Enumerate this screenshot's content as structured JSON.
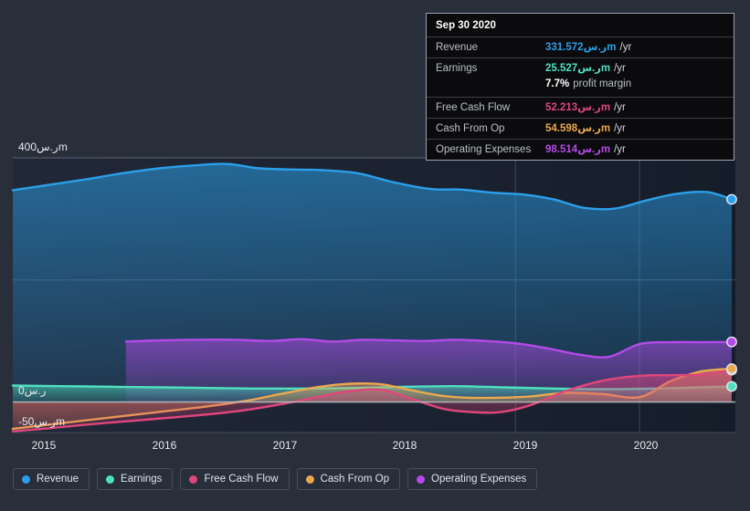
{
  "colors": {
    "background": "#282e3a",
    "plot_background": "#1b2230",
    "revenue": "#2b9fe8",
    "earnings": "#4fe0c0",
    "free_cash_flow": "#e0467c",
    "cash_from_op": "#eaa84f",
    "operating_expenses": "#b44ae8",
    "zero_line": "#b9c0c8",
    "grid": "#4a5264"
  },
  "tooltip": {
    "title": "Sep 30 2020",
    "rows": [
      {
        "label": "Revenue",
        "value": "331.572ر.سm",
        "unit": "/yr",
        "color": "#2b9fe8"
      },
      {
        "label": "Earnings",
        "value": "25.527ر.سm",
        "unit": "/yr",
        "color": "#4fe0c0"
      },
      {
        "label": "Free Cash Flow",
        "value": "52.213ر.سm",
        "unit": "/yr",
        "color": "#e0467c"
      },
      {
        "label": "Cash From Op",
        "value": "54.598ر.سm",
        "unit": "/yr",
        "color": "#eaa84f"
      },
      {
        "label": "Operating Expenses",
        "value": "98.514ر.سm",
        "unit": "/yr",
        "color": "#b44ae8"
      }
    ],
    "profit_margin_value": "7.7%",
    "profit_margin_label": "profit margin"
  },
  "legend": {
    "items": [
      {
        "label": "Revenue",
        "color": "#2b9fe8"
      },
      {
        "label": "Earnings",
        "color": "#4fe0c0"
      },
      {
        "label": "Free Cash Flow",
        "color": "#e0467c"
      },
      {
        "label": "Cash From Op",
        "color": "#eaa84f"
      },
      {
        "label": "Operating Expenses",
        "color": "#b44ae8"
      }
    ]
  },
  "axes": {
    "y_labels": [
      "400ر.سm",
      "0ر.س",
      "-50ر.سm"
    ],
    "x_labels": [
      "2015",
      "2016",
      "2017",
      "2018",
      "2019",
      "2020"
    ]
  },
  "chart_data": {
    "type": "area",
    "title": "",
    "xlabel": "",
    "ylabel": "ر.س millions",
    "ylim": [
      -50,
      400
    ],
    "yticks": [
      400,
      0,
      -50
    ],
    "ytick_labels": [
      "400ر.سm",
      "0ر.س",
      "-50ر.سm"
    ],
    "grid": true,
    "legend_position": "bottom",
    "x": [
      "2015",
      "2016",
      "2017",
      "2018",
      "2019",
      "2020",
      "Sep 30 2020"
    ],
    "xlim": [
      "2014.75",
      "2020.9"
    ],
    "series": [
      {
        "name": "Revenue",
        "color": "#2b9fe8",
        "x": [
          2014.9,
          2015.2,
          2015.5,
          2015.8,
          2016.1,
          2016.4,
          2016.65,
          2016.9,
          2017.15,
          2017.4,
          2017.7,
          2018.0,
          2018.3,
          2018.55,
          2018.8,
          2019.05,
          2019.3,
          2019.55,
          2019.8,
          2020.05,
          2020.3,
          2020.55,
          2020.75
        ],
        "values": [
          347,
          356,
          365,
          375,
          383,
          388,
          390,
          383,
          381,
          380,
          375,
          360,
          349,
          348,
          343,
          340,
          332,
          318,
          317,
          330,
          341,
          344,
          332
        ]
      },
      {
        "name": "Earnings",
        "color": "#4fe0c0",
        "x": [
          2014.9,
          2015.3,
          2015.7,
          2016.1,
          2016.5,
          2016.9,
          2017.3,
          2017.7,
          2018.1,
          2018.5,
          2018.9,
          2019.3,
          2019.7,
          2020.1,
          2020.5,
          2020.75
        ],
        "values": [
          27,
          26,
          25,
          24,
          23,
          22,
          22,
          23,
          25,
          26,
          24,
          22,
          21,
          22,
          24,
          25.527
        ]
      },
      {
        "name": "Free Cash Flow",
        "color": "#e0467c",
        "x": [
          2014.9,
          2015.2,
          2015.5,
          2015.8,
          2016.1,
          2016.45,
          2016.8,
          2017.1,
          2017.4,
          2017.65,
          2017.9,
          2018.15,
          2018.4,
          2018.6,
          2018.85,
          2019.1,
          2019.4,
          2019.7,
          2020.0,
          2020.25,
          2020.5,
          2020.75
        ],
        "values": [
          -48,
          -43,
          -37,
          -32,
          -27,
          -21,
          -13,
          -3,
          9,
          18,
          20,
          5,
          -11,
          -16,
          -17,
          -6,
          18,
          35,
          43,
          44,
          45,
          52.213
        ]
      },
      {
        "name": "Cash From Op",
        "color": "#eaa84f",
        "x": [
          2014.9,
          2015.2,
          2015.5,
          2015.8,
          2016.1,
          2016.45,
          2016.8,
          2017.1,
          2017.4,
          2017.65,
          2017.9,
          2018.15,
          2018.4,
          2018.6,
          2018.85,
          2019.1,
          2019.4,
          2019.7,
          2020.0,
          2020.25,
          2020.5,
          2020.75
        ],
        "values": [
          -44,
          -37,
          -30,
          -23,
          -16,
          -8,
          2,
          14,
          25,
          30,
          29,
          19,
          10,
          7,
          7,
          9,
          15,
          13,
          8,
          34,
          50,
          54.598
        ]
      },
      {
        "name": "Operating Expenses",
        "color": "#b44ae8",
        "x": [
          2015.82,
          2016.1,
          2016.4,
          2016.7,
          2017.0,
          2017.25,
          2017.5,
          2017.75,
          2018.0,
          2018.25,
          2018.5,
          2018.75,
          2019.0,
          2019.25,
          2019.5,
          2019.75,
          2020.0,
          2020.25,
          2020.5,
          2020.75
        ],
        "values": [
          99,
          101,
          102,
          102,
          100,
          103,
          99,
          102,
          101,
          100,
          102,
          100,
          96,
          88,
          78,
          74,
          95,
          98,
          98,
          98.514
        ]
      }
    ]
  }
}
